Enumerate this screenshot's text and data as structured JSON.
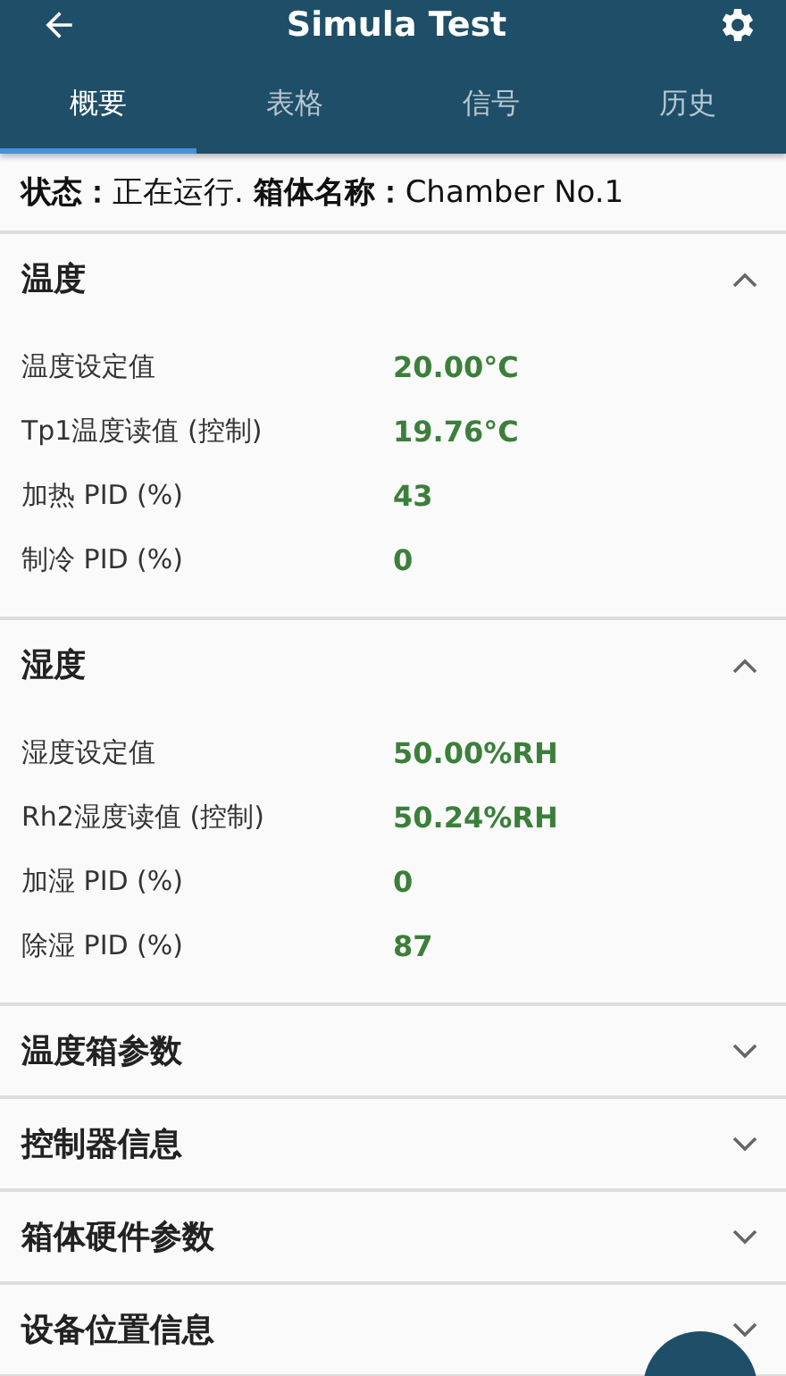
{
  "app_bar": {
    "title": "Simula Test"
  },
  "tabs": [
    {
      "label": "概要",
      "selected": true
    },
    {
      "label": "表格",
      "selected": false
    },
    {
      "label": "信号",
      "selected": false
    },
    {
      "label": "历史",
      "selected": false
    }
  ],
  "status": {
    "status_label": "状态：",
    "status_value": "正在运行.",
    "name_label": "箱体名称：",
    "name_value": "Chamber No.1"
  },
  "sections": [
    {
      "title": "温度",
      "expanded": true,
      "rows": [
        {
          "label": "温度设定值",
          "value": "20.00°C"
        },
        {
          "label": "Tp1温度读值 (控制)",
          "value": "19.76°C"
        },
        {
          "label": "加热 PID (%)",
          "value": "43"
        },
        {
          "label": "制冷 PID (%)",
          "value": "0"
        }
      ]
    },
    {
      "title": "湿度",
      "expanded": true,
      "rows": [
        {
          "label": "湿度设定值",
          "value": "50.00%RH"
        },
        {
          "label": "Rh2湿度读值 (控制)",
          "value": "50.24%RH"
        },
        {
          "label": "加湿 PID (%)",
          "value": "0"
        },
        {
          "label": "除湿 PID (%)",
          "value": "87"
        }
      ]
    },
    {
      "title": "温度箱参数",
      "expanded": false
    },
    {
      "title": "控制器信息",
      "expanded": false
    },
    {
      "title": "箱体硬件参数",
      "expanded": false
    },
    {
      "title": "设备位置信息",
      "expanded": false
    }
  ]
}
